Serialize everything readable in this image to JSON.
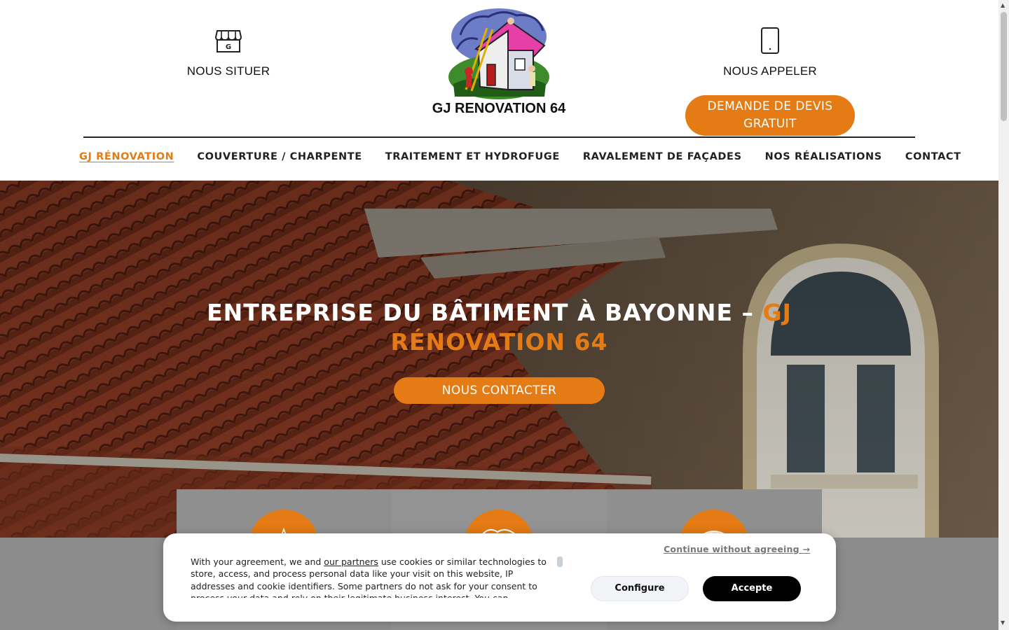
{
  "header": {
    "locate_label": "NOUS SITUER",
    "call_label": "NOUS APPELER",
    "logo_text": "GJ RENOVATION 64",
    "quote_button": "DEMANDE DE DEVIS GRATUIT"
  },
  "nav": {
    "items": [
      {
        "label": "GJ RÉNOVATION",
        "active": true
      },
      {
        "label": "COUVERTURE / CHARPENTE"
      },
      {
        "label": "TRAITEMENT ET HYDROFUGE"
      },
      {
        "label": "RAVALEMENT DE FAÇADES"
      },
      {
        "label": "NOS RÉALISATIONS"
      },
      {
        "label": "CONTACT"
      }
    ]
  },
  "hero": {
    "title_main": "ENTREPRISE DU BÂTIMENT À BAYONNE – ",
    "title_accent": "GJ RÉNOVATION 64",
    "cta": "NOUS CONTACTER"
  },
  "cookie": {
    "text_before": "With your agreement, we and ",
    "partners_link": "our partners",
    "text_after": " use cookies or similar technologies to store, access, and process personal data like your visit on this website, IP addresses and cookie identifiers. Some partners do not ask for your consent to process your data and rely on their legitimate business interest. You can",
    "continue": "Continue without agreeing →",
    "configure": "Configure",
    "accept": "Accepte"
  },
  "colors": {
    "accent": "#e47b14",
    "nav_text": "#222222",
    "accept_bg": "#000000"
  },
  "icons": [
    "storefront-g-icon",
    "smartphone-icon",
    "star-badge-icon",
    "handshake-icon",
    "eye-icon"
  ]
}
